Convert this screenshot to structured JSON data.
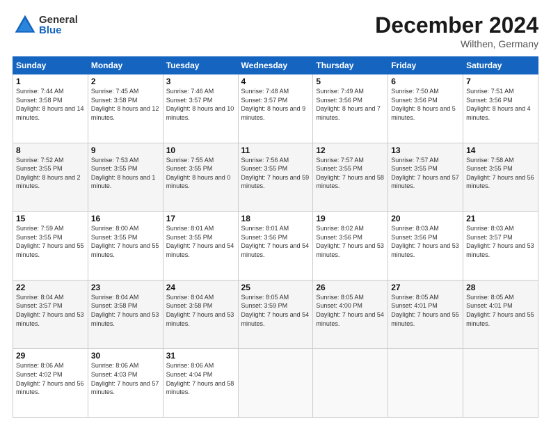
{
  "header": {
    "logo_general": "General",
    "logo_blue": "Blue",
    "month": "December 2024",
    "location": "Wilthen, Germany"
  },
  "days_of_week": [
    "Sunday",
    "Monday",
    "Tuesday",
    "Wednesday",
    "Thursday",
    "Friday",
    "Saturday"
  ],
  "weeks": [
    [
      {
        "num": "1",
        "sunrise": "7:44 AM",
        "sunset": "3:58 PM",
        "daylight": "8 hours and 14 minutes."
      },
      {
        "num": "2",
        "sunrise": "7:45 AM",
        "sunset": "3:58 PM",
        "daylight": "8 hours and 12 minutes."
      },
      {
        "num": "3",
        "sunrise": "7:46 AM",
        "sunset": "3:57 PM",
        "daylight": "8 hours and 10 minutes."
      },
      {
        "num": "4",
        "sunrise": "7:48 AM",
        "sunset": "3:57 PM",
        "daylight": "8 hours and 9 minutes."
      },
      {
        "num": "5",
        "sunrise": "7:49 AM",
        "sunset": "3:56 PM",
        "daylight": "8 hours and 7 minutes."
      },
      {
        "num": "6",
        "sunrise": "7:50 AM",
        "sunset": "3:56 PM",
        "daylight": "8 hours and 5 minutes."
      },
      {
        "num": "7",
        "sunrise": "7:51 AM",
        "sunset": "3:56 PM",
        "daylight": "8 hours and 4 minutes."
      }
    ],
    [
      {
        "num": "8",
        "sunrise": "7:52 AM",
        "sunset": "3:55 PM",
        "daylight": "8 hours and 2 minutes."
      },
      {
        "num": "9",
        "sunrise": "7:53 AM",
        "sunset": "3:55 PM",
        "daylight": "8 hours and 1 minute."
      },
      {
        "num": "10",
        "sunrise": "7:55 AM",
        "sunset": "3:55 PM",
        "daylight": "8 hours and 0 minutes."
      },
      {
        "num": "11",
        "sunrise": "7:56 AM",
        "sunset": "3:55 PM",
        "daylight": "7 hours and 59 minutes."
      },
      {
        "num": "12",
        "sunrise": "7:57 AM",
        "sunset": "3:55 PM",
        "daylight": "7 hours and 58 minutes."
      },
      {
        "num": "13",
        "sunrise": "7:57 AM",
        "sunset": "3:55 PM",
        "daylight": "7 hours and 57 minutes."
      },
      {
        "num": "14",
        "sunrise": "7:58 AM",
        "sunset": "3:55 PM",
        "daylight": "7 hours and 56 minutes."
      }
    ],
    [
      {
        "num": "15",
        "sunrise": "7:59 AM",
        "sunset": "3:55 PM",
        "daylight": "7 hours and 55 minutes."
      },
      {
        "num": "16",
        "sunrise": "8:00 AM",
        "sunset": "3:55 PM",
        "daylight": "7 hours and 55 minutes."
      },
      {
        "num": "17",
        "sunrise": "8:01 AM",
        "sunset": "3:55 PM",
        "daylight": "7 hours and 54 minutes."
      },
      {
        "num": "18",
        "sunrise": "8:01 AM",
        "sunset": "3:56 PM",
        "daylight": "7 hours and 54 minutes."
      },
      {
        "num": "19",
        "sunrise": "8:02 AM",
        "sunset": "3:56 PM",
        "daylight": "7 hours and 53 minutes."
      },
      {
        "num": "20",
        "sunrise": "8:03 AM",
        "sunset": "3:56 PM",
        "daylight": "7 hours and 53 minutes."
      },
      {
        "num": "21",
        "sunrise": "8:03 AM",
        "sunset": "3:57 PM",
        "daylight": "7 hours and 53 minutes."
      }
    ],
    [
      {
        "num": "22",
        "sunrise": "8:04 AM",
        "sunset": "3:57 PM",
        "daylight": "7 hours and 53 minutes."
      },
      {
        "num": "23",
        "sunrise": "8:04 AM",
        "sunset": "3:58 PM",
        "daylight": "7 hours and 53 minutes."
      },
      {
        "num": "24",
        "sunrise": "8:04 AM",
        "sunset": "3:58 PM",
        "daylight": "7 hours and 53 minutes."
      },
      {
        "num": "25",
        "sunrise": "8:05 AM",
        "sunset": "3:59 PM",
        "daylight": "7 hours and 54 minutes."
      },
      {
        "num": "26",
        "sunrise": "8:05 AM",
        "sunset": "4:00 PM",
        "daylight": "7 hours and 54 minutes."
      },
      {
        "num": "27",
        "sunrise": "8:05 AM",
        "sunset": "4:01 PM",
        "daylight": "7 hours and 55 minutes."
      },
      {
        "num": "28",
        "sunrise": "8:05 AM",
        "sunset": "4:01 PM",
        "daylight": "7 hours and 55 minutes."
      }
    ],
    [
      {
        "num": "29",
        "sunrise": "8:06 AM",
        "sunset": "4:02 PM",
        "daylight": "7 hours and 56 minutes."
      },
      {
        "num": "30",
        "sunrise": "8:06 AM",
        "sunset": "4:03 PM",
        "daylight": "7 hours and 57 minutes."
      },
      {
        "num": "31",
        "sunrise": "8:06 AM",
        "sunset": "4:04 PM",
        "daylight": "7 hours and 58 minutes."
      },
      null,
      null,
      null,
      null
    ]
  ],
  "labels": {
    "sunrise_prefix": "Sunrise: ",
    "sunset_prefix": "Sunset: ",
    "daylight_prefix": "Daylight: "
  }
}
